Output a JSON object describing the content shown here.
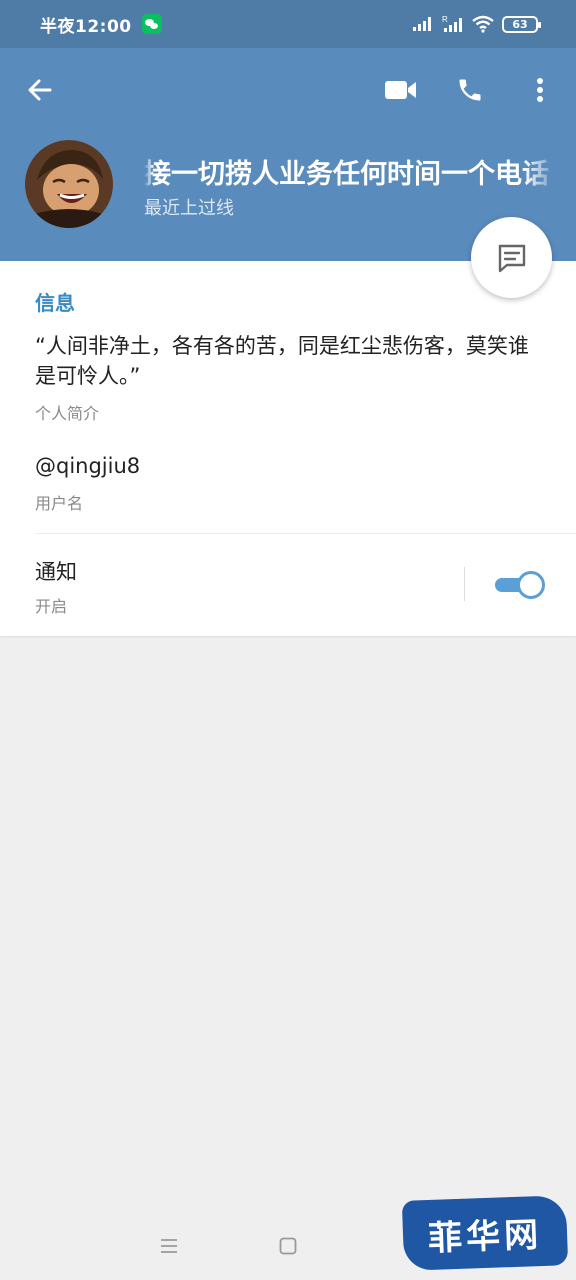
{
  "status_bar": {
    "time": "半夜12:00",
    "battery": "63",
    "icons": [
      "wechat-icon",
      "signal-icon",
      "signal-roaming-icon",
      "wifi-icon",
      "battery-icon"
    ]
  },
  "header": {
    "back_icon": "arrow-left-icon",
    "video_icon": "video-camera-icon",
    "call_icon": "phone-icon",
    "more_icon": "more-vertical-icon",
    "name": "接一切捞人业务任何时间一个电话",
    "status": "最近上过线",
    "accent_color": "#5a8bbd"
  },
  "fab": {
    "icon": "message-icon"
  },
  "info": {
    "title": "信息",
    "bio": "“人间非净土，各有各的苦，同是红尘悲伤客，莫笑谁是可怜人。”",
    "bio_caption": "个人简介",
    "username": "@qingjiu8",
    "username_caption": "用户名",
    "notifications_label": "通知",
    "notifications_state": "开启",
    "notifications_on": true
  },
  "navbar": {
    "icons": [
      "menu-icon",
      "home-icon"
    ]
  },
  "watermark": {
    "text": "菲华网"
  }
}
